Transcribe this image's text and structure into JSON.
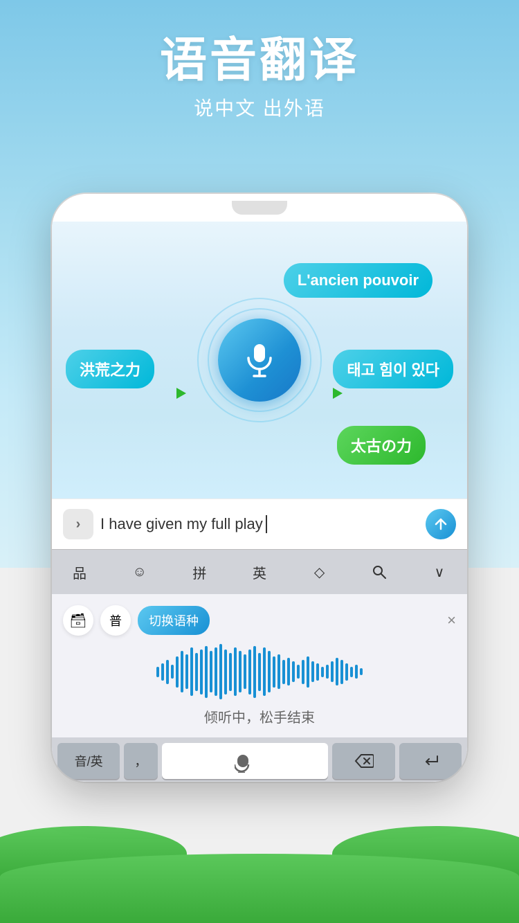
{
  "app": {
    "title": "语音翻译",
    "subtitle": "说中文 出外语"
  },
  "translation": {
    "bubble_french": "L'ancien pouvoir",
    "bubble_chinese": "洪荒之力",
    "bubble_korean": "태고 힘이 있다",
    "bubble_japanese": "太古の力"
  },
  "input": {
    "text": "I have given my full play",
    "arrow_label": "›"
  },
  "keyboard": {
    "toolbar_items": [
      "品",
      "☺",
      "拼",
      "英",
      "◇",
      "🔍",
      "∨"
    ],
    "voice_badges": [
      "🗃",
      "普"
    ],
    "switch_label": "切换语种",
    "close_label": "×",
    "hint": "倾听中，松手结束"
  },
  "bottom_row": {
    "key1": "音/英",
    "key2": "，",
    "mic_label": "🎤",
    "delete_label": "⌫",
    "return_label": "↵"
  },
  "colors": {
    "sky_blue": "#7ec8e8",
    "teal_bubble": "#00b8d9",
    "green_bubble": "#2db82d",
    "mic_blue": "#1890d4",
    "grass_green": "#5bc85b"
  }
}
